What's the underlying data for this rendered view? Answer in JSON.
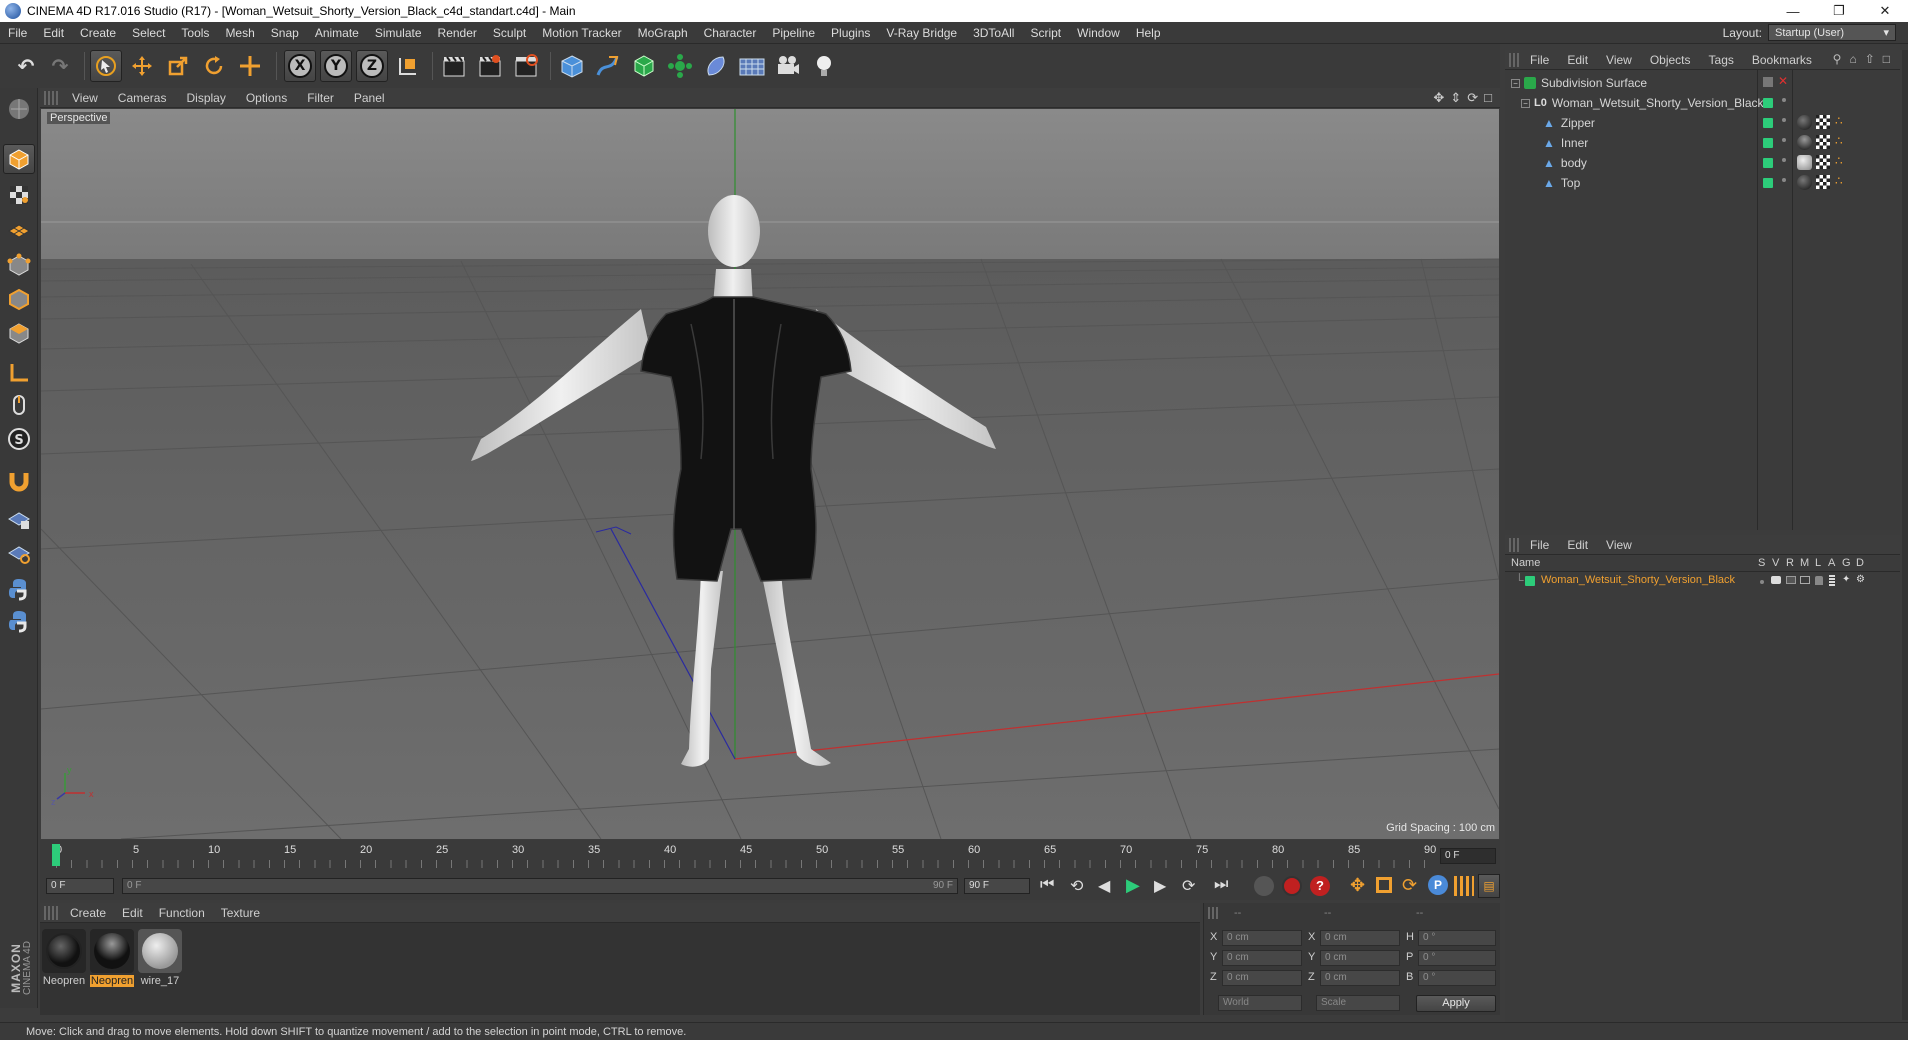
{
  "window": {
    "title": "CINEMA 4D R17.016 Studio (R17) - [Woman_Wetsuit_Shorty_Version_Black_c4d_standart.c4d] - Main",
    "controls": [
      "minimize-icon",
      "restore-icon",
      "close-icon"
    ]
  },
  "menubar": {
    "items": [
      "File",
      "Edit",
      "Create",
      "Select",
      "Tools",
      "Mesh",
      "Snap",
      "Animate",
      "Simulate",
      "Render",
      "Sculpt",
      "Motion Tracker",
      "MoGraph",
      "Character",
      "Pipeline",
      "Plugins",
      "V-Ray Bridge",
      "3DToAll",
      "Script",
      "Window",
      "Help"
    ],
    "layout_label": "Layout:",
    "layout_value": "Startup (User)"
  },
  "toolbar": {
    "axis_labels": [
      "X",
      "Y",
      "Z"
    ]
  },
  "viewport": {
    "menu": [
      "View",
      "Cameras",
      "Display",
      "Options",
      "Filter",
      "Panel"
    ],
    "camera_label": "Perspective",
    "grid_spacing": "Grid Spacing : 100 cm",
    "axis_x": "x",
    "axis_y": "y",
    "axis_z": "z"
  },
  "timeline": {
    "ticks": [
      "0",
      "5",
      "10",
      "15",
      "20",
      "25",
      "30",
      "35",
      "40",
      "45",
      "50",
      "55",
      "60",
      "65",
      "70",
      "75",
      "80",
      "85",
      "90"
    ],
    "current_frame": "0 F",
    "start_field": "0 F",
    "range_start": "0 F",
    "range_end": "90 F",
    "end_field": "90 F"
  },
  "materials": {
    "menu": [
      "Create",
      "Edit",
      "Function",
      "Texture"
    ],
    "items": [
      {
        "label": "Neopren",
        "selected": false
      },
      {
        "label": "Neopren",
        "selected": true
      },
      {
        "label": "wire_17",
        "selected": false
      }
    ],
    "brand_top": "MAXON",
    "brand_bottom": "CINEMA 4D"
  },
  "coordinates": {
    "headers": [
      "--",
      "--",
      "--"
    ],
    "rows": [
      {
        "l1": "X",
        "v1": "0 cm",
        "l2": "X",
        "v2": "0 cm",
        "l3": "H",
        "v3": "0 °"
      },
      {
        "l1": "Y",
        "v1": "0 cm",
        "l2": "Y",
        "v2": "0 cm",
        "l3": "P",
        "v3": "0 °"
      },
      {
        "l1": "Z",
        "v1": "0 cm",
        "l2": "Z",
        "v2": "0 cm",
        "l3": "B",
        "v3": "0 °"
      }
    ],
    "mode_world": "World",
    "mode_scale": "Scale",
    "apply": "Apply"
  },
  "objects": {
    "menu": [
      "File",
      "Edit",
      "View",
      "Objects",
      "Tags",
      "Bookmarks"
    ],
    "tree": [
      {
        "name": "Subdivision Surface",
        "indent": 0
      },
      {
        "name": "Woman_Wetsuit_Shorty_Version_Black",
        "indent": 1
      },
      {
        "name": "Zipper",
        "indent": 2
      },
      {
        "name": "Inner",
        "indent": 2
      },
      {
        "name": "body",
        "indent": 2
      },
      {
        "name": "Top",
        "indent": 2
      }
    ]
  },
  "layers": {
    "menu": [
      "File",
      "Edit",
      "View"
    ],
    "col_name": "Name",
    "cols": [
      "S",
      "V",
      "R",
      "M",
      "L",
      "A",
      "G",
      "D"
    ],
    "row_name": "Woman_Wetsuit_Shorty_Version_Black"
  },
  "status": {
    "text": "Move: Click and drag to move elements. Hold down SHIFT to quantize movement / add to the selection in point mode, CTRL to remove."
  },
  "colors": {
    "accent_orange": "#f0a030",
    "layer_green": "#2dcc7a",
    "grid_red": "#c03030"
  }
}
